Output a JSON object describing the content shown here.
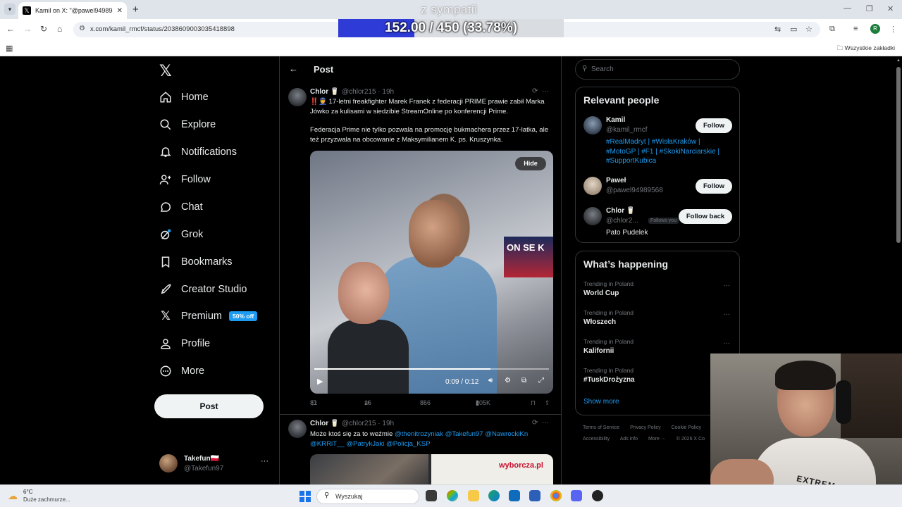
{
  "browser": {
    "tab_title": "Kamil on X: \"@pawel94989568",
    "url": "x.com/kamil_rmcf/status/2038609003035418898",
    "bookmarks_all": "Wszystkie zakładki",
    "profile_initial": "R"
  },
  "overlay": {
    "label": "z sympatii",
    "progress_text": "152.00 / 450 (33.78%)",
    "progress_fraction": 0.3378
  },
  "nav": {
    "items": [
      {
        "label": "Home",
        "icon": "home-icon"
      },
      {
        "label": "Explore",
        "icon": "search-icon"
      },
      {
        "label": "Notifications",
        "icon": "bell-icon"
      },
      {
        "label": "Follow",
        "icon": "add-person-icon"
      },
      {
        "label": "Chat",
        "icon": "chat-icon"
      },
      {
        "label": "Grok",
        "icon": "grok-icon"
      },
      {
        "label": "Bookmarks",
        "icon": "bookmark-icon"
      },
      {
        "label": "Creator Studio",
        "icon": "rocket-icon"
      },
      {
        "label": "Premium",
        "icon": "x-icon"
      },
      {
        "label": "Profile",
        "icon": "person-icon"
      },
      {
        "label": "More",
        "icon": "more-circle-icon"
      }
    ],
    "premium_badge": "50% off",
    "post_button": "Post",
    "account": {
      "name": "Takefun🇵🇱",
      "handle": "@Takefun97"
    }
  },
  "main": {
    "header_title": "Post",
    "tweet1": {
      "name": "Chlor 🥛",
      "handle": "@chlor215 · 19h",
      "text1": "‼️👮 17-letni freakfighter Marek Franek z federacji PRIME prawie zabił Marka Jówko za kulisami w siedzibie StreamOnline po konferencji Prime.",
      "text2": "Federacja Prime nie tylko pozwala na promocję bukmachera przez 17-latka, ale też przyzwala na obcowanie z Maksymilianem K. ps. Kruszynka.",
      "video": {
        "hide": "Hide",
        "time": "0:09 / 0:12",
        "progress": 0.75,
        "tv_text": "ON SE K"
      },
      "stats": {
        "replies": "81",
        "reposts": "16",
        "likes": "866",
        "views": "205K"
      }
    },
    "tweet2": {
      "name": "Chlor 🥛",
      "handle": "@chlor215 · 19h",
      "text_prefix": "Może ktoś się za to weźmie ",
      "mentions_line1": "@thenitrozyniak @Takefun97 @NawrockiKn",
      "mentions_line2": "@KRRiT__ @PatrykJaki @Policja_KSP",
      "image_brand": "wyborcza.pl"
    }
  },
  "right": {
    "search_placeholder": "Search",
    "relevant_title": "Relevant people",
    "people": [
      {
        "name": "Kamil",
        "handle": "@kamil_rmcf",
        "button": "Follow",
        "bio_line1": "#RealMadryt | #WisłaKraków |",
        "bio_line2": "#MotoGP | #F1 | #SkokiNarciarskie |",
        "bio_line3": "#SupportKubica"
      },
      {
        "name": "Paweł",
        "handle": "@pawel94989568",
        "button": "Follow"
      },
      {
        "name": "Chlor 🥛",
        "handle": "@chlor2...",
        "button": "Follow back",
        "follows_you": "Follows you",
        "bio": "Pato Pudelek"
      }
    ],
    "happening_title": "What’s happening",
    "trends": [
      {
        "category": "Trending in Poland",
        "name": "World Cup"
      },
      {
        "category": "Trending in Poland",
        "name": "Włoszech"
      },
      {
        "category": "Trending in Poland",
        "name": "Kalifornii"
      },
      {
        "category": "Trending in Poland",
        "name": "#TuskDrożyzna"
      }
    ],
    "show_more": "Show more",
    "footer1": [
      "Terms of Service",
      "Privacy Policy",
      "Cookie Policy"
    ],
    "footer2": [
      "Accessibility",
      "Ads info",
      "More ···",
      "© 2026 X Co"
    ]
  },
  "webcam": {
    "shirt_text": "EXTREM"
  },
  "taskbar": {
    "temperature": "6°C",
    "weather": "Duże zachmurze...",
    "search_placeholder": "Wyszukaj"
  },
  "colors": {
    "accent": "#1d9bf0",
    "overlay_fill": "#2e3bd6",
    "background": "#000000"
  }
}
